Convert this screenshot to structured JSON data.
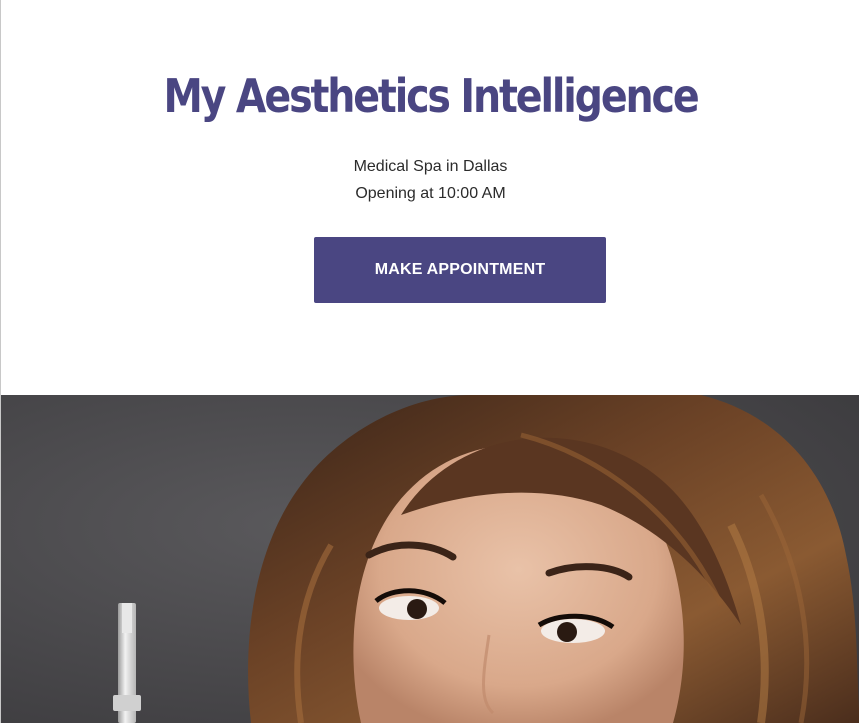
{
  "business": {
    "name": "My Aesthetics Intelligence",
    "category": "Medical Spa in Dallas",
    "hours_status": "Opening at 10:00 AM"
  },
  "cta": {
    "label": "MAKE APPOINTMENT"
  },
  "hero": {
    "subject": "portrait photo"
  },
  "colors": {
    "brand": "#4a4682",
    "text": "#2b2b2b",
    "hero_background": "#4e4d50"
  }
}
